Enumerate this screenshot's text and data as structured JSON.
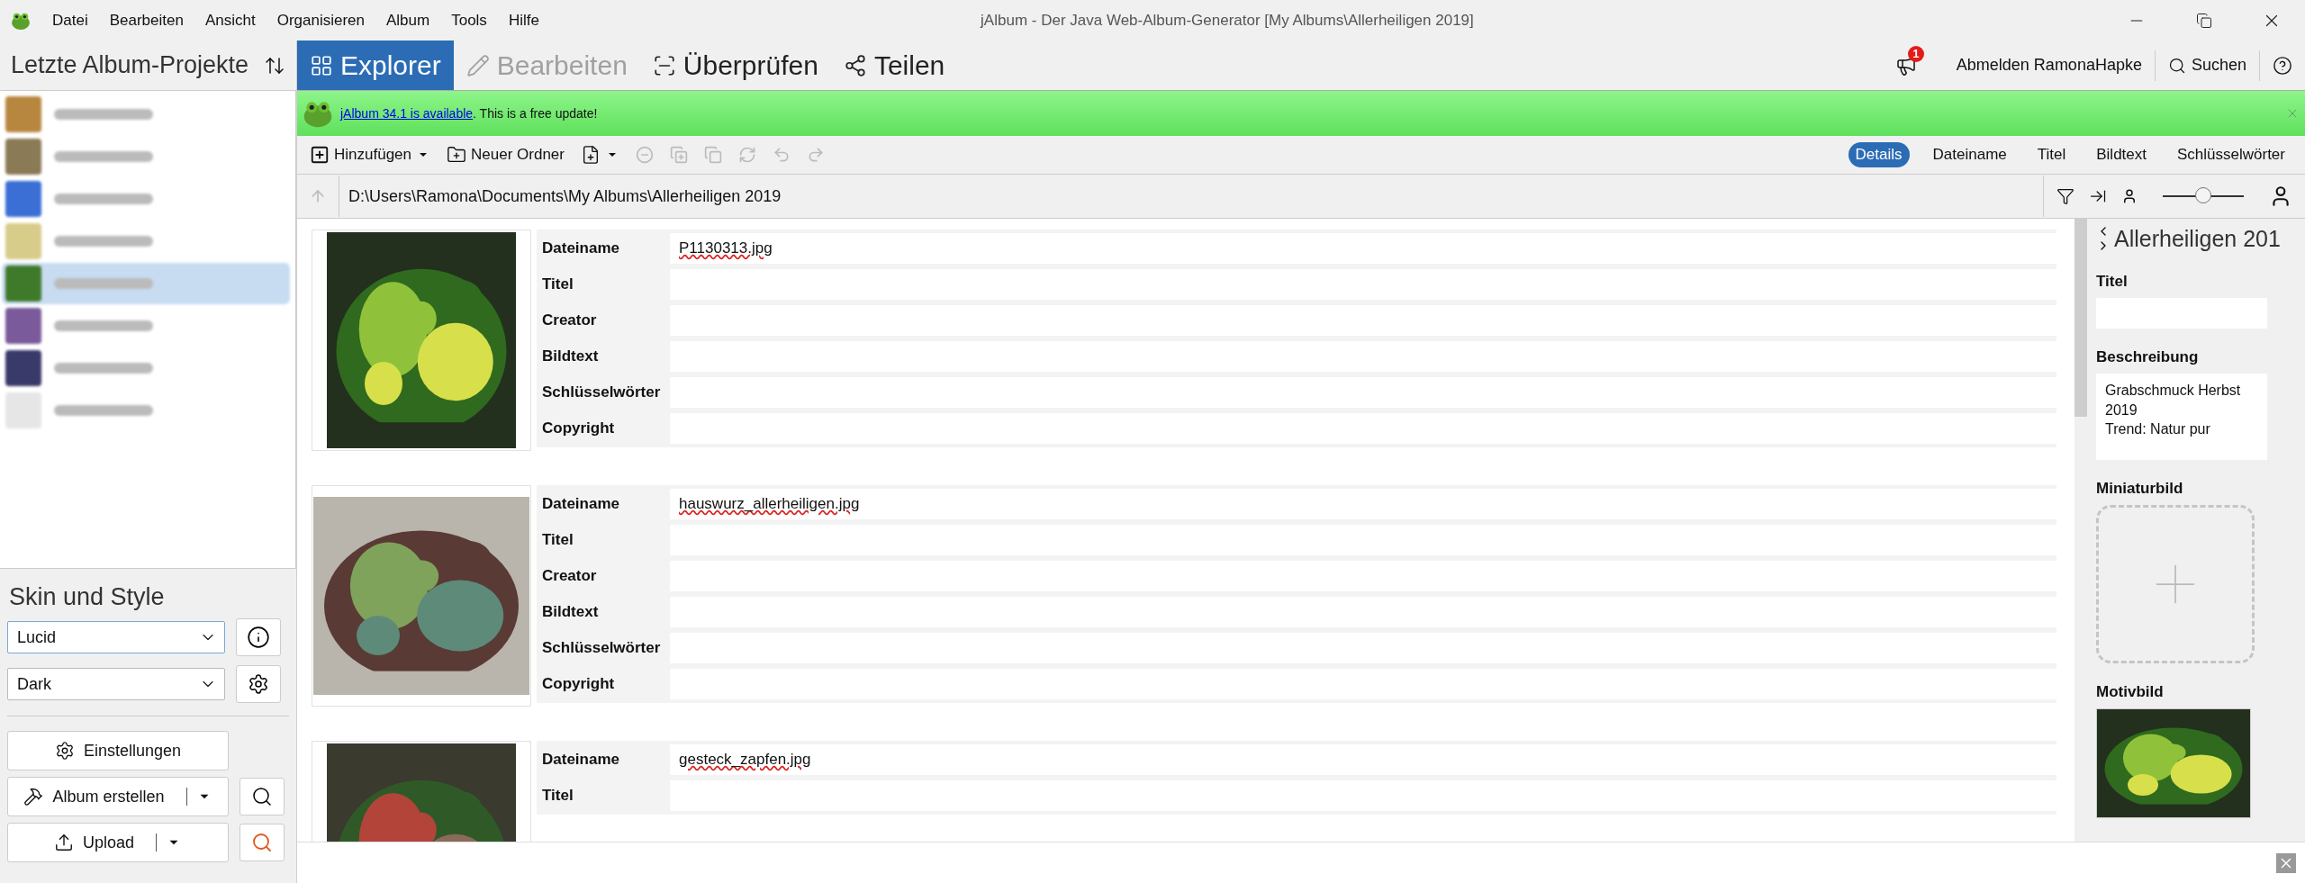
{
  "window": {
    "title": "jAlbum - Der Java Web-Album-Generator [My Albums\\Allerheiligen 2019]"
  },
  "menu": [
    "Datei",
    "Bearbeiten",
    "Ansicht",
    "Organisieren",
    "Album",
    "Tools",
    "Hilfe"
  ],
  "sidebar": {
    "title": "Letzte Album-Projekte",
    "projects": [
      {
        "color": "#b8873f",
        "selected": false
      },
      {
        "color": "#8a7a55",
        "selected": false
      },
      {
        "color": "#3b6fd6",
        "selected": false
      },
      {
        "color": "#d8cc8a",
        "selected": false
      },
      {
        "color": "#3f7a2a",
        "selected": true
      },
      {
        "color": "#7a5a9a",
        "selected": false
      },
      {
        "color": "#3a3a6a",
        "selected": false
      },
      {
        "color": "#e6e6e6",
        "selected": false
      }
    ],
    "skin_title": "Skin und Style",
    "skin": "Lucid",
    "style": "Dark",
    "buttons": [
      {
        "label": "Einstellungen",
        "kind": "settings"
      },
      {
        "label": "Album erstellen",
        "kind": "make"
      },
      {
        "label": "Upload",
        "kind": "upload"
      }
    ]
  },
  "tabs": [
    {
      "label": "Explorer",
      "selected": true,
      "disabled": false,
      "kind": "grid"
    },
    {
      "label": "Bearbeiten",
      "selected": false,
      "disabled": true,
      "kind": "edit"
    },
    {
      "label": "Überprüfen",
      "selected": false,
      "disabled": false,
      "kind": "preview"
    },
    {
      "label": "Teilen",
      "selected": false,
      "disabled": false,
      "kind": "share"
    }
  ],
  "header_right": {
    "notification_count": "1",
    "account": "Abmelden RamonaHapke",
    "search": "Suchen"
  },
  "update_banner": {
    "link": "jAlbum 34.1 is available",
    "text": ". This is a free update!"
  },
  "toolbar": {
    "add": "Hinzufügen",
    "new_folder": "Neuer Ordner",
    "view_modes": [
      {
        "label": "Details",
        "selected": true
      },
      {
        "label": "Dateiname",
        "selected": false
      },
      {
        "label": "Titel",
        "selected": false
      },
      {
        "label": "Bildtext",
        "selected": false
      },
      {
        "label": "Schlüsselwörter",
        "selected": false
      }
    ]
  },
  "path": "D:\\Users\\Ramona\\Documents\\My Albums\\Allerheiligen 2019",
  "thumb_size": {
    "level": 0.5
  },
  "images": [
    {
      "kind": "picture",
      "fields": [
        {
          "label": "Dateiname",
          "value": "P1130313.jpg",
          "misspelled": true
        },
        {
          "label": "Titel"
        },
        {
          "label": "Creator"
        },
        {
          "label": "Bildtext"
        },
        {
          "label": "Schlüsselwörter"
        },
        {
          "label": "Copyright"
        }
      ]
    },
    {
      "kind": "picture",
      "fields": [
        {
          "label": "Dateiname",
          "value": "hauswurz_allerheiligen.jpg",
          "misspelled": true
        },
        {
          "label": "Titel"
        },
        {
          "label": "Creator"
        },
        {
          "label": "Bildtext"
        },
        {
          "label": "Schlüsselwörter"
        },
        {
          "label": "Copyright"
        }
      ]
    },
    {
      "kind": "picture",
      "fields": [
        {
          "label": "Dateiname",
          "value": "gesteck_zapfen.jpg",
          "misspelled": true
        },
        {
          "label": "Titel"
        }
      ]
    }
  ],
  "details_panel": {
    "title": "Allerheiligen 201",
    "title_label": "Titel",
    "description_label": "Beschreibung",
    "description": [
      "Grabschmuck Herbst",
      "2019",
      "Trend: Natur pur"
    ],
    "thumbnail_label": "Miniaturbild",
    "cover_label": "Motivbild"
  }
}
